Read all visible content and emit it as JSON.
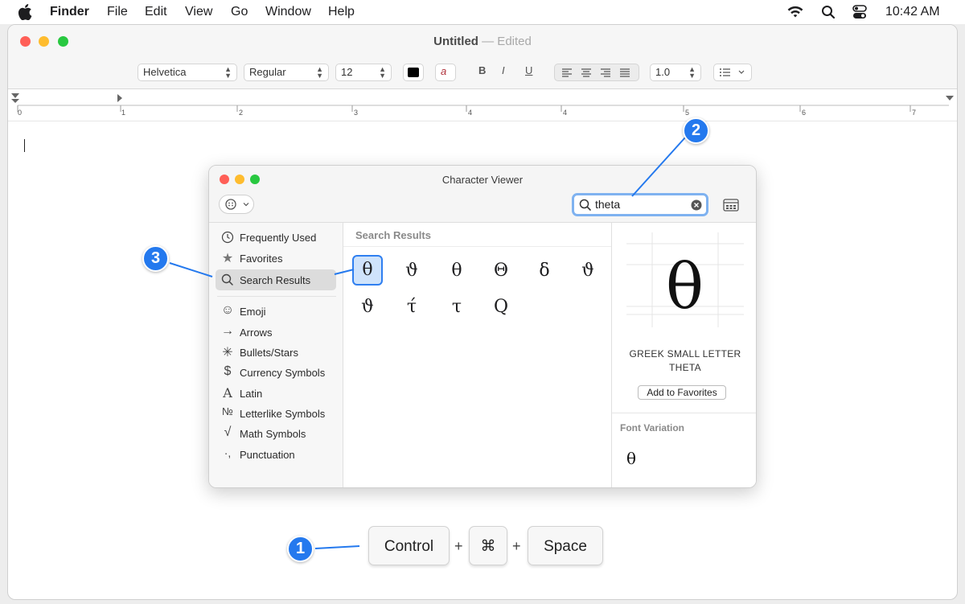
{
  "menubar": {
    "app_name": "Finder",
    "items": [
      "File",
      "Edit",
      "View",
      "Go",
      "Window",
      "Help"
    ],
    "clock": "10:42 AM"
  },
  "window": {
    "title": "Untitled",
    "subtitle": "— Edited",
    "toolbar": {
      "font_family": "Helvetica",
      "font_style": "Regular",
      "font_size": "12",
      "text_color": "#000000",
      "bold": "B",
      "italic": "I",
      "underline": "U",
      "line_spacing": "1.0"
    },
    "ruler_numbers": [
      "0",
      "1",
      "2",
      "3",
      "4",
      "4",
      "5",
      "6",
      "7"
    ]
  },
  "character_viewer": {
    "title": "Character Viewer",
    "search_value": "theta",
    "sidebar": [
      {
        "label": "Frequently Used",
        "icon": "clock-icon"
      },
      {
        "label": "Favorites",
        "icon": "star-icon"
      },
      {
        "label": "Search Results",
        "icon": "magnifier-icon",
        "selected": true
      },
      {
        "label": "Emoji",
        "icon": "smiley-icon"
      },
      {
        "label": "Arrows",
        "icon": "arrow-icon"
      },
      {
        "label": "Bullets/Stars",
        "icon": "asterisk-icon"
      },
      {
        "label": "Currency Symbols",
        "icon": "dollar-icon"
      },
      {
        "label": "Latin",
        "icon": "latin-a-icon"
      },
      {
        "label": "Letterlike Symbols",
        "icon": "numero-icon"
      },
      {
        "label": "Math Symbols",
        "icon": "sqrt-icon"
      },
      {
        "label": "Punctuation",
        "icon": "punctuation-icon"
      }
    ],
    "sidebar_glyphs": [
      "🕘",
      "★",
      "⌕",
      "☺",
      "→",
      "✳",
      "$",
      "A",
      "№",
      "√",
      "·,"
    ],
    "results_heading": "Search Results",
    "results": [
      "θ",
      "ϑ",
      "θ",
      "Θ",
      "ẟ",
      "ϑ",
      "ϑ",
      "τ́",
      "τ",
      "Q"
    ],
    "selected_index": 0,
    "detail": {
      "glyph": "θ",
      "name_line1": "GREEK SMALL LETTER",
      "name_line2": "THETA",
      "add_favorites": "Add to Favorites",
      "font_variation_heading": "Font Variation",
      "font_variation_glyph": "θ"
    }
  },
  "callouts": [
    "1",
    "2",
    "3"
  ],
  "shortcut": {
    "keys": [
      "Control",
      "⌘",
      "Space"
    ],
    "plus": "+"
  },
  "colors": {
    "accent": "#2479ee",
    "close": "#ff5f57",
    "minimize": "#febc2e",
    "zoom": "#28c840"
  }
}
